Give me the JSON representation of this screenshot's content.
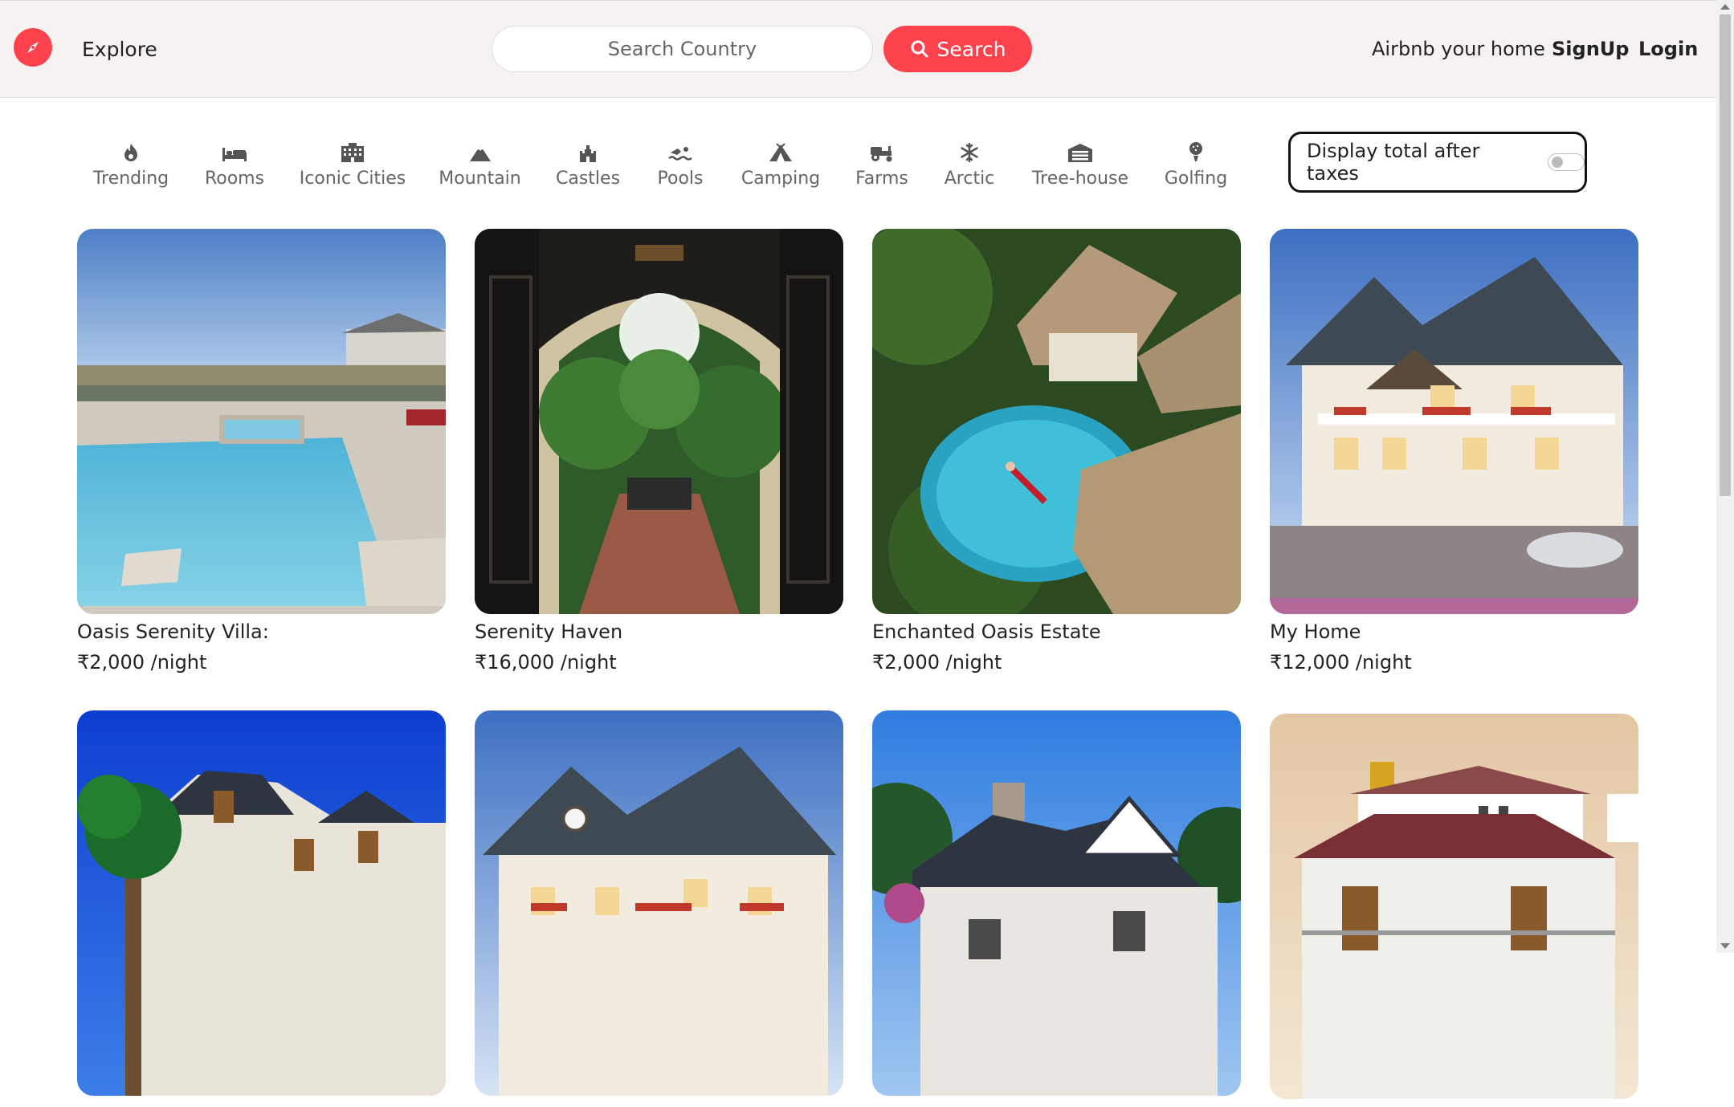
{
  "header": {
    "logo_icon": "compass-icon",
    "explore_label": "Explore",
    "search_placeholder": "Search Country",
    "search_button_label": "Search",
    "host_label": "Airbnb your home",
    "signup_label": "SignUp",
    "login_label": "Login",
    "brand_color": "#fe424d"
  },
  "filters": [
    {
      "label": "Trending",
      "icon": "fire-icon"
    },
    {
      "label": "Rooms",
      "icon": "bed-icon"
    },
    {
      "label": "Iconic Cities",
      "icon": "city-icon"
    },
    {
      "label": "Mountain",
      "icon": "mountain-icon"
    },
    {
      "label": "Castles",
      "icon": "castle-icon"
    },
    {
      "label": "Pools",
      "icon": "swimmer-icon"
    },
    {
      "label": "Camping",
      "icon": "tent-icon"
    },
    {
      "label": "Farms",
      "icon": "tractor-icon"
    },
    {
      "label": "Arctic",
      "icon": "snowflake-icon"
    },
    {
      "label": "Tree-house",
      "icon": "treehouse-icon"
    },
    {
      "label": "Golfing",
      "icon": "golf-ball-icon"
    }
  ],
  "tax_toggle": {
    "label": "Display total after taxes",
    "checked": false
  },
  "listings": [
    {
      "title": "Oasis Serenity Villa:",
      "price": "₹2,000 /night"
    },
    {
      "title": "Serenity Haven",
      "price": "₹16,000 /night"
    },
    {
      "title": "Enchanted Oasis Estate",
      "price": "₹2,000 /night"
    },
    {
      "title": "My Home",
      "price": "₹12,000 /night"
    },
    {
      "title": "",
      "price": ""
    },
    {
      "title": "",
      "price": ""
    },
    {
      "title": "",
      "price": ""
    },
    {
      "title": "",
      "price": ""
    }
  ]
}
